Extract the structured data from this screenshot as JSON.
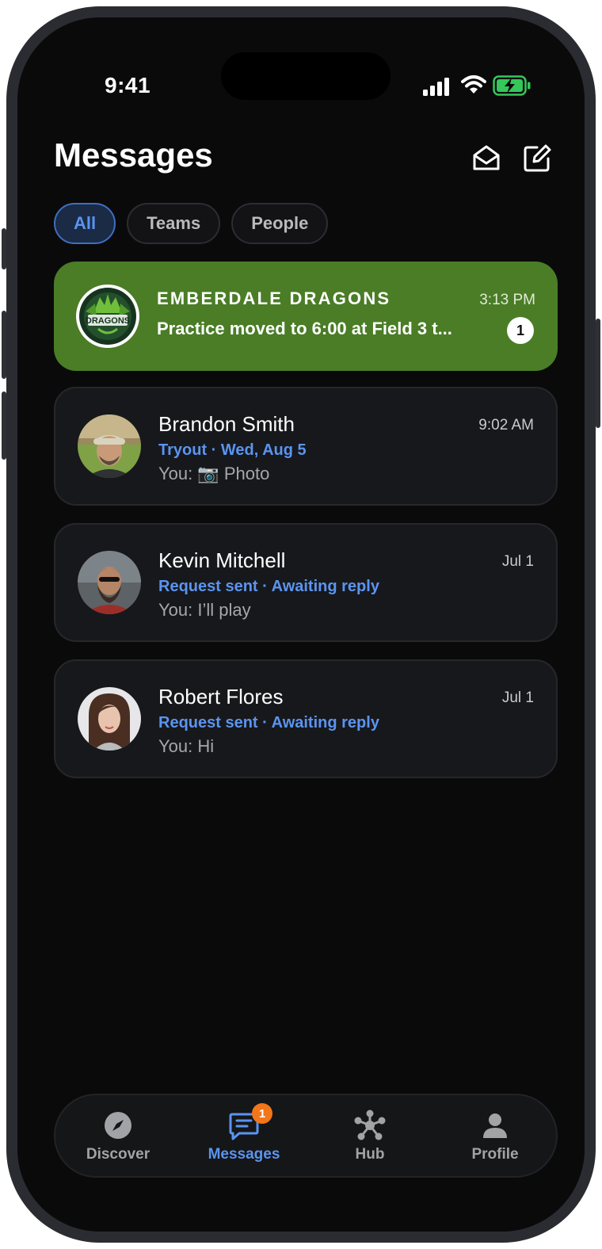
{
  "status_bar": {
    "time": "9:41"
  },
  "header": {
    "title": "Messages",
    "mark_read_icon": "envelope-open-icon",
    "compose_icon": "compose-icon"
  },
  "filters": [
    {
      "label": "All",
      "active": true
    },
    {
      "label": "Teams",
      "active": false
    },
    {
      "label": "People",
      "active": false
    }
  ],
  "conversations": [
    {
      "name": "EMBERDALE DRAGONS",
      "time": "3:13 PM",
      "preview": "Practice moved to 6:00 at Field 3 t...",
      "unread": "1",
      "logo_text": "DRAGONS",
      "highlight_color": "#4a7d26"
    },
    {
      "name": "Brandon Smith",
      "time": "9:02 AM",
      "status": "Tryout · Wed, Aug 5",
      "preview": "You: 📷 Photo"
    },
    {
      "name": "Kevin Mitchell",
      "time": "Jul 1",
      "status": "Request sent · Awaiting reply",
      "preview": "You: I’ll play"
    },
    {
      "name": "Robert Flores",
      "time": "Jul 1",
      "status": "Request sent · Awaiting reply",
      "preview": "You: Hi"
    }
  ],
  "tab_bar": {
    "items": [
      {
        "label": "Discover",
        "icon": "compass-icon"
      },
      {
        "label": "Messages",
        "icon": "chat-icon",
        "badge": "1",
        "active": true
      },
      {
        "label": "Hub",
        "icon": "hub-icon"
      },
      {
        "label": "Profile",
        "icon": "person-icon"
      }
    ]
  },
  "colors": {
    "accent": "#5b94f0",
    "team_card": "#4a7d26",
    "badge": "#f2761a",
    "background": "#0a0a0b"
  }
}
